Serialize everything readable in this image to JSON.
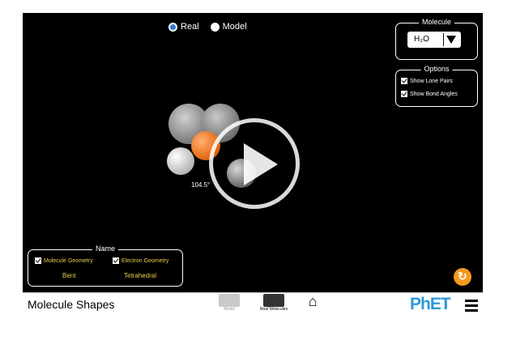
{
  "mode": {
    "options": [
      {
        "label": "Real",
        "selected": true
      },
      {
        "label": "Model",
        "selected": false
      }
    ]
  },
  "molecule_panel": {
    "legend": "Molecule",
    "selected": "H₂O"
  },
  "options_panel": {
    "legend": "Options",
    "items": [
      "Show Lone Pairs",
      "Show Bond Angles"
    ]
  },
  "name_panel": {
    "legend": "Name",
    "items": [
      {
        "label": "Molecule Geometry",
        "value": "Bent"
      },
      {
        "label": "Electron Geometry",
        "value": "Tetrahedral"
      }
    ]
  },
  "bond_angle": "104.5°",
  "toolbar": {
    "title": "Molecule Shapes",
    "tabs": [
      "Model",
      "Real Molecules"
    ],
    "logo": "PhET"
  },
  "colors": {
    "oxygen": "#e86e1c",
    "hydrogen": "#e8e8e8",
    "selected_radio": "#2e7bd6",
    "reset": "#f39a21",
    "name_text": "#e8d14a"
  }
}
